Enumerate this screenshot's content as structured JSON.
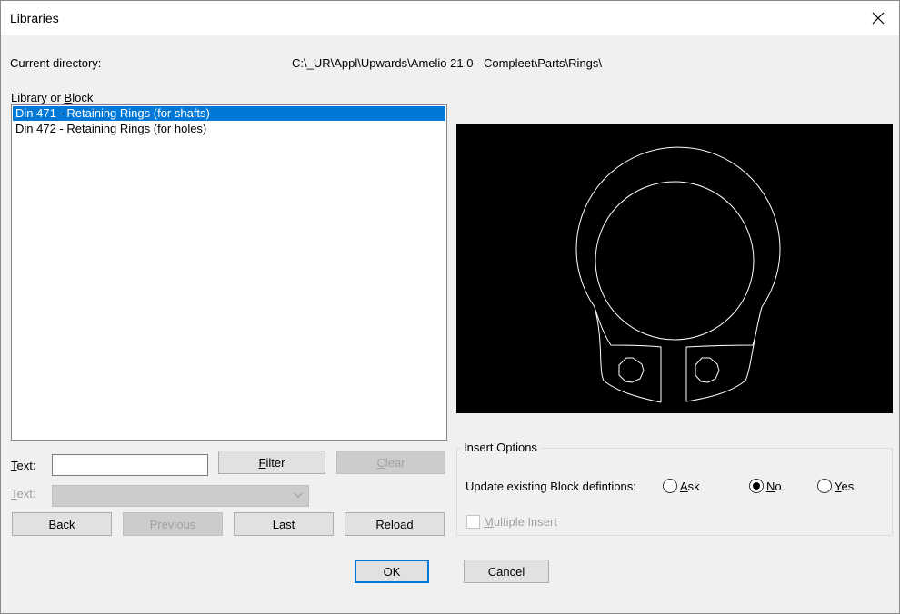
{
  "window": {
    "title": "Libraries"
  },
  "directory": {
    "label": "Current directory:",
    "path": "C:\\_UR\\Appl\\Upwards\\Amelio 21.0 - Compleet\\Parts\\Rings\\"
  },
  "library": {
    "label_pre": "Library or ",
    "label_access": "B",
    "label_post": "lock",
    "items": [
      "Din 471 - Retaining Rings (for shafts)",
      "Din 472 - Retaining Rings (for holes)"
    ],
    "selected_index": 0
  },
  "filter": {
    "text_label_access": "T",
    "text_label_post": "ext:",
    "text_value": "",
    "text2_label_access": "T",
    "text2_label_post": "ext:",
    "combo_value": "",
    "filter_button_access": "F",
    "filter_button_post": "ilter",
    "clear_button_access": "C",
    "clear_button_post": "lear"
  },
  "nav": {
    "back_access": "B",
    "back_post": "ack",
    "previous_access": "P",
    "previous_post": "revious",
    "last_access": "L",
    "last_post": "ast",
    "reload_access": "R",
    "reload_post": "eload"
  },
  "insert_options": {
    "group_title": "Insert Options",
    "update_label": "Update existing Block defintions:",
    "ask_access": "A",
    "ask_post": "sk",
    "no_access": "N",
    "no_post": "o",
    "yes_access": "Y",
    "yes_post": "es",
    "selected": "No",
    "multiple_access": "M",
    "multiple_post": "ultiple Insert",
    "multiple_checked": false
  },
  "dialog_buttons": {
    "ok": "OK",
    "cancel": "Cancel"
  },
  "icons": {
    "close": "close-icon",
    "dropdown": "chevron-down-icon"
  },
  "colors": {
    "selection": "#0078d7",
    "preview_bg": "#000000",
    "drawing_stroke": "#ffffff"
  }
}
